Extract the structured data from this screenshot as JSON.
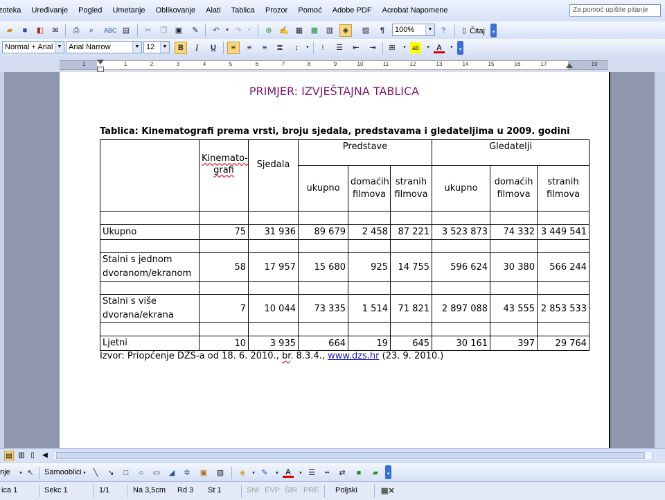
{
  "menu": {
    "items": [
      "zoteka",
      "Uređivanje",
      "Pogled",
      "Umetanje",
      "Oblikovanje",
      "Alati",
      "Tablica",
      "Prozor",
      "Pomoć",
      "Adobe PDF",
      "Acrobat Napomene"
    ],
    "help_placeholder": "Za pomoć upišite pitanje"
  },
  "standard_toolbar": {
    "zoom": "100%",
    "read_label": "Čitaj"
  },
  "format_toolbar": {
    "style": "Normal + Arial I",
    "font": "Arial Narrow",
    "size": "12",
    "bold": "B",
    "italic": "I",
    "underline": "U",
    "highlight_label": "ab"
  },
  "ruler": {
    "ticks": [
      "1",
      "1",
      "2",
      "3",
      "4",
      "5",
      "6",
      "7",
      "8",
      "9",
      "10",
      "11",
      "12",
      "13",
      "14",
      "15",
      "16",
      "17",
      "19"
    ]
  },
  "document": {
    "title": "PRIMJER: IZVJEŠTAJNA TABLICA",
    "caption": "Tablica: Kinematografi prema vrsti, broju sjedala, predstavama i gledateljima u 2009. godini",
    "table": {
      "col_kinematografi_a": "Kinemato-",
      "col_kinematografi_b": "grafi",
      "col_sjedala": "Sjedala",
      "group_predstave": "Predstave",
      "group_gledatelji": "Gledatelji",
      "sub_ukupno": "ukupno",
      "sub_domacih": "domaćih filmova",
      "sub_stranih": "stranih filmova",
      "rows": [
        {
          "label": "Ukupno",
          "kino": "75",
          "sjedala": "31 936",
          "p_uk": "89 679",
          "p_dom": "2 458",
          "p_str": "87 221",
          "g_uk": "3 523 873",
          "g_dom": "74 332",
          "g_str": "3 449 541"
        },
        {
          "label": "Stalni s jednom dvoranom/ekranom",
          "kino": "58",
          "sjedala": "17 957",
          "p_uk": "15 680",
          "p_dom": "925",
          "p_str": "14 755",
          "g_uk": "596 624",
          "g_dom": "30 380",
          "g_str": "566 244"
        },
        {
          "label": "Stalni s više dvorana/ekrana",
          "kino": "7",
          "sjedala": "10 044",
          "p_uk": "73 335",
          "p_dom": "1 514",
          "p_str": "71 821",
          "g_uk": "2 897 088",
          "g_dom": "43 555",
          "g_str": "2 853 533"
        },
        {
          "label": "Ljetni",
          "kino": "10",
          "sjedala": "3 935",
          "p_uk": "664",
          "p_dom": "19",
          "p_str": "645",
          "g_uk": "30 161",
          "g_dom": "397",
          "g_str": "29 764"
        }
      ]
    },
    "source_a": "Izvor: Priopćenje DZS-a od 18. 6. 2010., ",
    "source_br": "br",
    "source_b": ". 8.3.4., ",
    "source_link": "www.dzs.hr",
    "source_c": " (23. 9. 2010.)"
  },
  "drawing_toolbar": {
    "draw_label": "nje",
    "autoshapes_label": "Samooblici"
  },
  "status": {
    "page": "ica 1",
    "section": "Sekc 1",
    "pages": "1/1",
    "at": "Na 3,5cm",
    "line": "Rd 3",
    "col": "St 1",
    "rec": "SNI",
    "trk": "EVP",
    "ext": "ŠIR",
    "ovr": "PRE",
    "language": "Poljski"
  },
  "colors": {
    "title_color": "#7e1a6e",
    "link_color": "#1a1aa6",
    "ui_blue": "#d6e2f7"
  }
}
